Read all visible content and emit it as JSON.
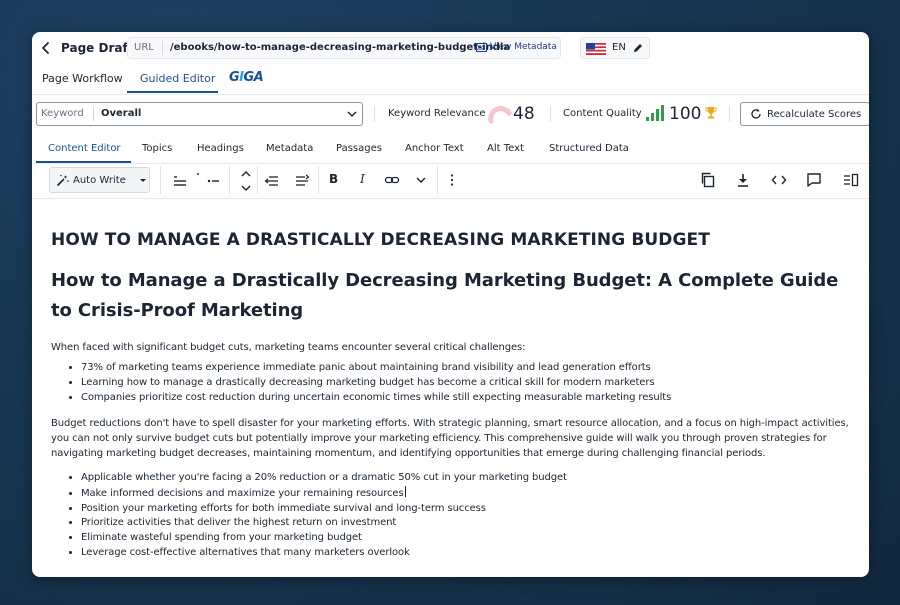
{
  "header": {
    "title": "Page Draft",
    "url_label": "URL",
    "url_value": "/ebooks/how-to-manage-decreasing-marketing-budget-india",
    "view_metadata": "View Metadata",
    "language": "EN"
  },
  "workflow_tabs": {
    "page_workflow": "Page Workflow",
    "guided_editor": "Guided Editor",
    "giga_logo": "GIGA"
  },
  "score_bar": {
    "keyword_label": "Keyword",
    "keyword_value": "Overall",
    "keyword_relevance_label": "Keyword Relevance",
    "keyword_relevance_value": "48",
    "content_quality_label": "Content Quality",
    "content_quality_value": "100",
    "recalculate_label": "Recalculate Scores"
  },
  "section_tabs": [
    "Content Editor",
    "Topics",
    "Headings",
    "Metadata",
    "Passages",
    "Anchor Text",
    "Alt Text",
    "Structured Data"
  ],
  "toolbar": {
    "auto_write": "Auto Write",
    "bold": "B",
    "italic": "I"
  },
  "document": {
    "h1": "HOW TO MANAGE A DRASTICALLY DECREASING MARKETING BUDGET",
    "h2": "How to Manage a Drastically Decreasing Marketing Budget: A Complete Guide to Crisis-Proof Marketing",
    "intro": "When faced with significant budget cuts, marketing teams encounter several critical challenges:",
    "list1": [
      "73% of marketing teams experience immediate panic about maintaining brand visibility and lead generation efforts",
      "Learning how to manage a drastically decreasing marketing budget has become a critical skill for modern marketers",
      "Companies prioritize cost reduction during uncertain economic times while still expecting measurable marketing results"
    ],
    "paragraph": "Budget reductions don't have to spell disaster for your marketing efforts. With strategic planning, smart resource allocation, and a focus on high-impact activities, you can not only survive budget cuts but potentially improve your marketing efficiency. This comprehensive guide will walk you through proven strategies for navigating marketing budget decreases, maintaining momentum, and identifying opportunities that emerge during challenging financial periods.",
    "list2": [
      "Applicable whether you're facing a 20% reduction or a dramatic 50% cut in your marketing budget",
      "Make informed decisions and maximize your remaining resources",
      "Position your marketing efforts for both immediate survival and long-term success",
      "Prioritize activities that deliver the highest return on investment",
      "Eliminate wasteful spending from your marketing budget",
      "Leverage cost-effective alternatives that many marketers overlook"
    ]
  },
  "colors": {
    "accent": "#1d4f91",
    "quality_green": "#2e9e4a",
    "relevance_pink": "#f4c7cf",
    "trophy_gold": "#e8a91b"
  },
  "icons": [
    "back-arrow-icon",
    "metadata-icon",
    "us-flag-icon",
    "pencil-icon",
    "chevron-down-icon",
    "gauge-icon",
    "signal-bars-icon",
    "trophy-icon",
    "refresh-icon",
    "magic-wand-icon",
    "copy-icon",
    "download-icon",
    "code-icon",
    "comment-icon",
    "panel-icon"
  ]
}
